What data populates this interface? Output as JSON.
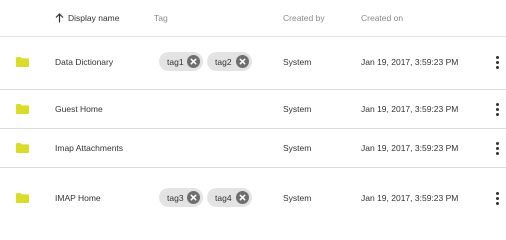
{
  "table": {
    "headers": {
      "display_name": "Display name",
      "tag": "Tag",
      "created_by": "Created by",
      "created_on": "Created on"
    },
    "rows": [
      {
        "name": "Data Dictionary",
        "tags": [
          "tag1",
          "tag2"
        ],
        "created_by": "System",
        "created_on": "Jan 19, 2017, 3:59:23 PM"
      },
      {
        "name": "Guest Home",
        "tags": [],
        "created_by": "System",
        "created_on": "Jan 19, 2017, 3:59:23 PM"
      },
      {
        "name": "Imap Attachments",
        "tags": [],
        "created_by": "System",
        "created_on": "Jan 19, 2017, 3:59:23 PM"
      },
      {
        "name": "IMAP Home",
        "tags": [
          "tag3",
          "tag4"
        ],
        "created_by": "System",
        "created_on": "Jan 19, 2017, 3:59:23 PM"
      }
    ]
  },
  "icons": {
    "sort": "arrow-up-icon",
    "row": "folder-icon",
    "chip_remove": "close-circle-icon",
    "row_menu": "more-vertical-icon"
  },
  "colors": {
    "folder": "#d9dd2a",
    "chip_bg": "#e3e3e3",
    "chip_remove": "#6e6e6e"
  }
}
